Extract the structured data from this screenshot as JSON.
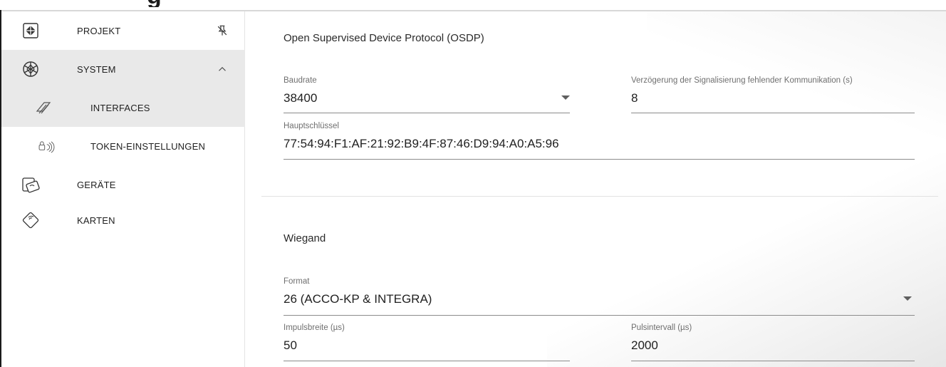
{
  "heading_fragment": "g",
  "sidebar": {
    "items": [
      {
        "label": "PROJEKT",
        "icon": "project-icon",
        "trailing": "pin-icon"
      },
      {
        "label": "SYSTEM",
        "icon": "system-icon",
        "trailing": "chevron-up-icon",
        "active": true
      },
      {
        "label": "INTERFACES",
        "icon": "interfaces-icon",
        "sub": true,
        "active": true
      },
      {
        "label": "TOKEN-EINSTELLUNGEN",
        "icon": "token-icon",
        "sub": true
      },
      {
        "label": "GERÄTE",
        "icon": "devices-icon"
      },
      {
        "label": "KARTEN",
        "icon": "cards-icon"
      }
    ]
  },
  "osdp": {
    "title": "Open Supervised Device Protocol (OSDP)",
    "baudrate": {
      "label": "Baudrate",
      "value": "38400"
    },
    "delay": {
      "label": "Verzögerung der Signalisierung fehlender Kommunikation (s)",
      "value": "8"
    },
    "key": {
      "label": "Hauptschlüssel",
      "value": "77:54:94:F1:AF:21:92:B9:4F:87:46:D9:94:A0:A5:96"
    }
  },
  "wiegand": {
    "title": "Wiegand",
    "format": {
      "label": "Format",
      "value": "26 (ACCO-KP & INTEGRA)"
    },
    "pulse_width": {
      "label": "Impulsbreite (µs)",
      "value": "50"
    },
    "pulse_interval": {
      "label": "Pulsintervall (µs)",
      "value": "2000"
    }
  },
  "colors": {
    "active_bg": "#e9e9e9",
    "text": "#212121",
    "label": "#6f6f6f",
    "underline": "#8c8c8c"
  }
}
